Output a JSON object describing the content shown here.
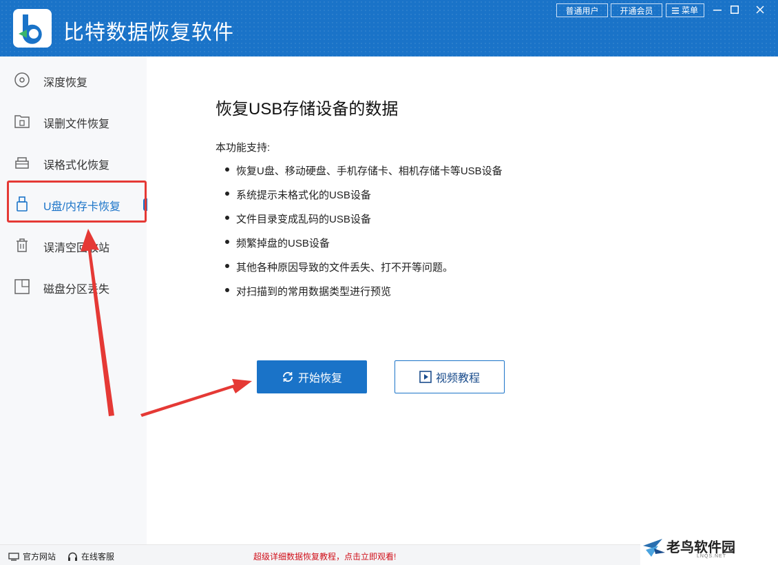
{
  "app": {
    "title": "比特数据恢复软件",
    "accent": "#1a73c8",
    "logo_icon": "bitdata-logo-icon"
  },
  "titlebar": {
    "account_label": "普通用户",
    "vip_label": "开通会员",
    "menu_label": "菜单",
    "menu_icon": "hamburger-icon",
    "minimize_icon": "minimize-icon",
    "maximize_icon": "maximize-icon",
    "close_icon": "close-icon"
  },
  "sidebar": {
    "items": [
      {
        "label": "深度恢复",
        "icon": "disc-icon"
      },
      {
        "label": "误删文件恢复",
        "icon": "folder-trash-icon"
      },
      {
        "label": "误格式化恢复",
        "icon": "drive-icon"
      },
      {
        "label": "U盘/内存卡恢复",
        "icon": "usb-icon",
        "active": true
      },
      {
        "label": "误清空回收站",
        "icon": "trash-icon"
      },
      {
        "label": "磁盘分区丢失",
        "icon": "partition-icon"
      }
    ]
  },
  "main": {
    "title": "恢复USB存储设备的数据",
    "support_label": "本功能支持:",
    "features": [
      "恢复U盘、移动硬盘、手机存储卡、相机存储卡等USB设备",
      "系统提示未格式化的USB设备",
      "文件目录变成乱码的USB设备",
      "频繁掉盘的USB设备",
      "其他各种原因导致的文件丢失、打不开等问题。",
      "对扫描到的常用数据类型进行预览"
    ],
    "start_button": "开始恢复",
    "video_button": "视频教程"
  },
  "footer": {
    "website_label": "官方网站",
    "service_label": "在线客服",
    "promo_text": "超级详细数据恢复教程，点击立即观看!",
    "promo_color": "#d0101a"
  },
  "watermark": {
    "text": "老鸟软件园",
    "subtext": "LNQS.NET"
  }
}
